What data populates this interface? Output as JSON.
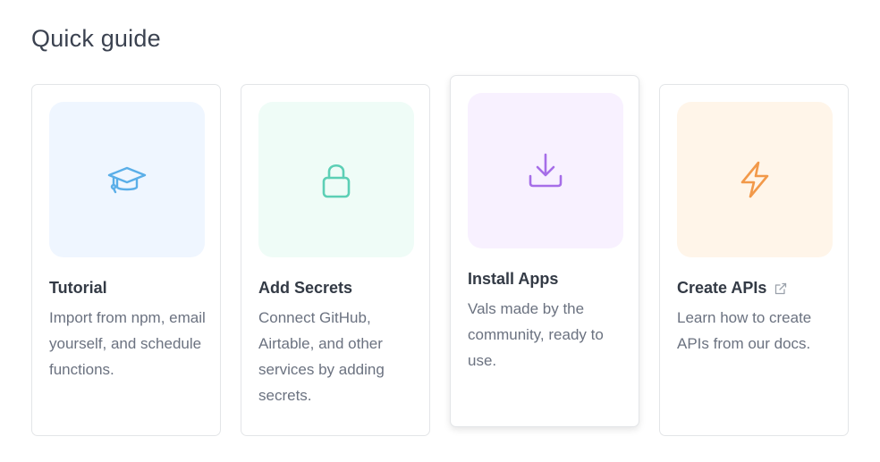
{
  "header": {
    "title": "Quick guide"
  },
  "cards": [
    {
      "title": "Tutorial",
      "description": "Import from npm, email yourself, and schedule functions.",
      "icon": "graduation-cap-icon",
      "tile_color": "#eff6ff",
      "icon_color": "#5aaee8"
    },
    {
      "title": "Add Secrets",
      "description": "Connect GitHub, Airtable, and other services by adding secrets.",
      "icon": "lock-icon",
      "tile_color": "#effcf7",
      "icon_color": "#5ccfb5"
    },
    {
      "title": "Install Apps",
      "description": "Vals made by the community, ready to use.",
      "icon": "download-icon",
      "tile_color": "#f8f1ff",
      "icon_color": "#a66ee8"
    },
    {
      "title": "Create APIs",
      "description": "Learn how to create APIs from our docs.",
      "icon": "lightning-icon",
      "tile_color": "#fff5e9",
      "icon_color": "#f2994a",
      "trailing_icon": "external-link-icon"
    }
  ]
}
